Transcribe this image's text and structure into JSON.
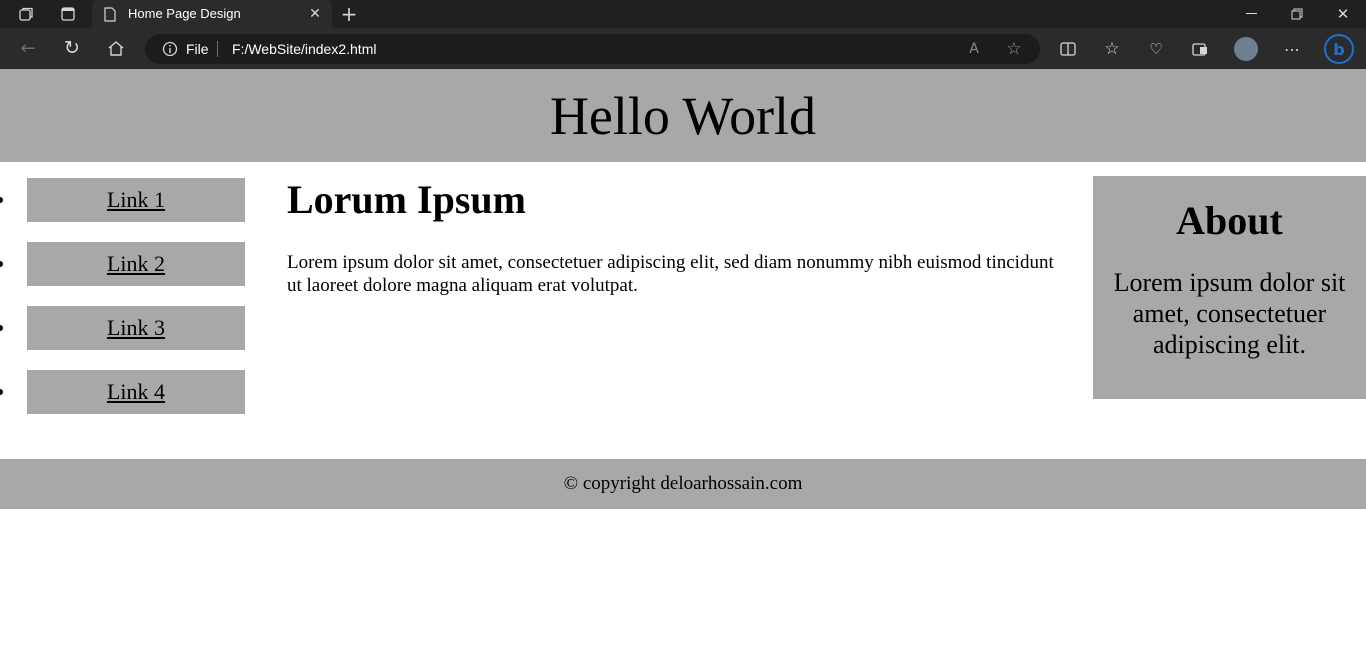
{
  "browser": {
    "tab_title": "Home Page Design",
    "address_scheme": "File",
    "address_url": "F:/WebSite/index2.html"
  },
  "page": {
    "header_title": "Hello World",
    "nav_links": [
      "Link 1",
      "Link 2",
      "Link 3",
      "Link 4"
    ],
    "main_heading": "Lorum Ipsum",
    "main_text": "Lorem ipsum dolor sit amet, consectetuer adipiscing elit, sed diam nonummy nibh euismod tincidunt ut laoreet dolore magna aliquam erat volutpat.",
    "aside_heading": "About",
    "aside_text": "Lorem ipsum dolor sit amet, consectetuer adipiscing elit.",
    "footer_text": "© copyright deloarhossain.com"
  },
  "colors": {
    "panel_gray": "#a8a8a8",
    "chrome_dark": "#202020"
  }
}
